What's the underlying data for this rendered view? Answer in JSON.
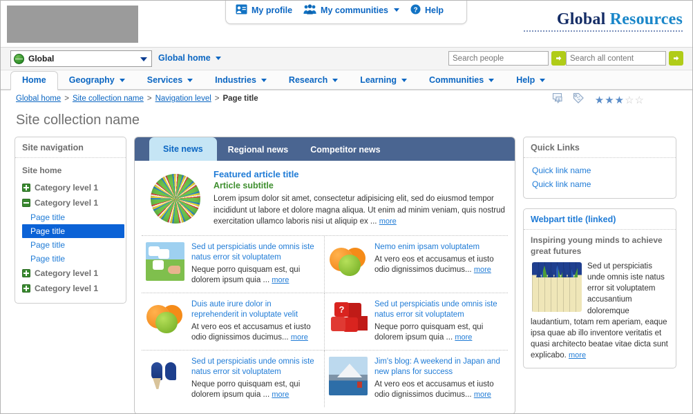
{
  "header": {
    "logo_placeholder": "logo-placeholder",
    "brand_primary": "Global",
    "brand_secondary": "Resources",
    "utility": [
      {
        "label": "My profile",
        "icon": "profile-card-icon",
        "has_caret": false
      },
      {
        "label": "My communities",
        "icon": "people-group-icon",
        "has_caret": true
      },
      {
        "label": "Help",
        "icon": "question-circle-icon",
        "has_caret": false
      }
    ]
  },
  "scope": {
    "select_value": "Global",
    "select_icon": "globe-icon",
    "home_link": "Global home",
    "search_people": {
      "placeholder": "Search people",
      "value": "",
      "go_icon": "arrow-right-icon"
    },
    "search_content": {
      "placeholder": "Search all content",
      "value": "",
      "go_icon": "arrow-right-icon"
    }
  },
  "nav_tabs": [
    {
      "label": "Home",
      "active": true,
      "has_caret": false
    },
    {
      "label": "Geography",
      "active": false,
      "has_caret": true
    },
    {
      "label": "Services",
      "active": false,
      "has_caret": true
    },
    {
      "label": "Industries",
      "active": false,
      "has_caret": true
    },
    {
      "label": "Research",
      "active": false,
      "has_caret": true
    },
    {
      "label": "Learning",
      "active": false,
      "has_caret": true
    },
    {
      "label": "Communities",
      "active": false,
      "has_caret": true
    },
    {
      "label": "Help",
      "active": false,
      "has_caret": true
    }
  ],
  "breadcrumb": {
    "items": [
      {
        "label": "Global home",
        "current": false
      },
      {
        "label": "Site collection name",
        "current": false
      },
      {
        "label": "Navigation level",
        "current": false
      },
      {
        "label": "Page title",
        "current": true
      }
    ],
    "separator": ">",
    "tools": [
      {
        "icon": "comment-icon"
      },
      {
        "icon": "tag-icon"
      }
    ],
    "rating": {
      "value": 3,
      "max": 5
    }
  },
  "page_title": "Site collection name",
  "sidebar": {
    "heading": "Site navigation",
    "home_label": "Site home",
    "items": [
      {
        "label": "Category level 1",
        "state": "collapsed",
        "type": "category"
      },
      {
        "label": "Category level 1",
        "state": "expanded",
        "type": "category"
      },
      {
        "label": "Page title",
        "type": "page",
        "selected": false
      },
      {
        "label": "Page title",
        "type": "page",
        "selected": true
      },
      {
        "label": "Page title",
        "type": "page",
        "selected": false
      },
      {
        "label": "Page title",
        "type": "page",
        "selected": false
      },
      {
        "label": "Category level 1",
        "state": "collapsed",
        "type": "category"
      },
      {
        "label": "Category level 1",
        "state": "collapsed",
        "type": "category"
      }
    ]
  },
  "news": {
    "tabs": [
      {
        "label": "Site news",
        "active": true
      },
      {
        "label": "Regional news",
        "active": false
      },
      {
        "label": "Competitor news",
        "active": false
      }
    ],
    "featured": {
      "thumb": "tangled-yarn-ball-image",
      "title": "Featured article title",
      "subtitle": "Article subtitle",
      "body": "Lorem ipsum dolor sit amet, consectetur adipisicing elit, sed do eiusmod tempor incididunt ut labore et dolore magna aliqua. Ut enim ad minim veniam, quis nostrud exercitation ullamco laboris nisi ut aliquip ex ...",
      "more_label": "more"
    },
    "articles": [
      {
        "thumb": "puzzle-pieces-landscape-image",
        "title": "Sed ut perspiciatis unde omnis iste natus error sit voluptatem",
        "body": "Neque porro quisquam est, qui dolorem ipsum quia ...",
        "more_label": "more"
      },
      {
        "thumb": "oranges-and-apple-image",
        "title": "Nemo enim ipsam voluptatem",
        "body": "At vero eos et accusamus et iusto odio dignissimos ducimus...",
        "more_label": "more"
      },
      {
        "thumb": "oranges-and-apple-image",
        "title": "Duis aute irure dolor in reprehenderit in voluptate velit",
        "body": "At vero eos et accusamus et iusto odio dignissimos ducimus...",
        "more_label": "more"
      },
      {
        "thumb": "question-mark-dice-image",
        "title": "Sed ut perspiciatis unde omnis iste natus error sit voluptatem",
        "body": "Neque porro quisquam est, qui dolorem ipsum quia ...",
        "more_label": "more"
      },
      {
        "thumb": "blue-high-heel-shoes-image",
        "title": "Sed ut perspiciatis unde omnis iste natus error sit voluptatem",
        "body": "Neque porro quisquam est, qui dolorem ipsum quia ...",
        "more_label": "more"
      },
      {
        "thumb": "mount-fuji-japan-image",
        "title": "Jim's blog: A weekend in Japan and new plans for success",
        "body": "At vero eos et accusamus et iusto odio dignissimos ducimus...",
        "more_label": "more"
      }
    ]
  },
  "quick_links": {
    "heading": "Quick Links",
    "links": [
      {
        "label": "Quick link name"
      },
      {
        "label": "Quick link name"
      }
    ]
  },
  "webpart": {
    "title": "Webpart title (linked)",
    "lead": "Inspiring young minds to achieve great futures",
    "thumb": "crayons-image",
    "body": "Sed ut perspiciatis unde omnis iste natus error sit voluptatem accusantium doloremque laudantium, totam rem aperiam, eaque ipsa quae ab illo inventore veritatis et quasi architecto beatae vitae dicta sunt explicabo.",
    "more_label": "more"
  },
  "colors": {
    "link_blue": "#1f7bd6",
    "nav_blue": "#0b66c2",
    "brand_navy": "#152d66",
    "brand_light": "#1b87c9",
    "tab_bar": "#4a6591",
    "active_tab_bg": "#c5e5f5",
    "selected_nav": "#0b62d6",
    "green_plus": "#39892f",
    "search_go": "#b0cc18",
    "subtitle_green": "#3f8f2f"
  }
}
